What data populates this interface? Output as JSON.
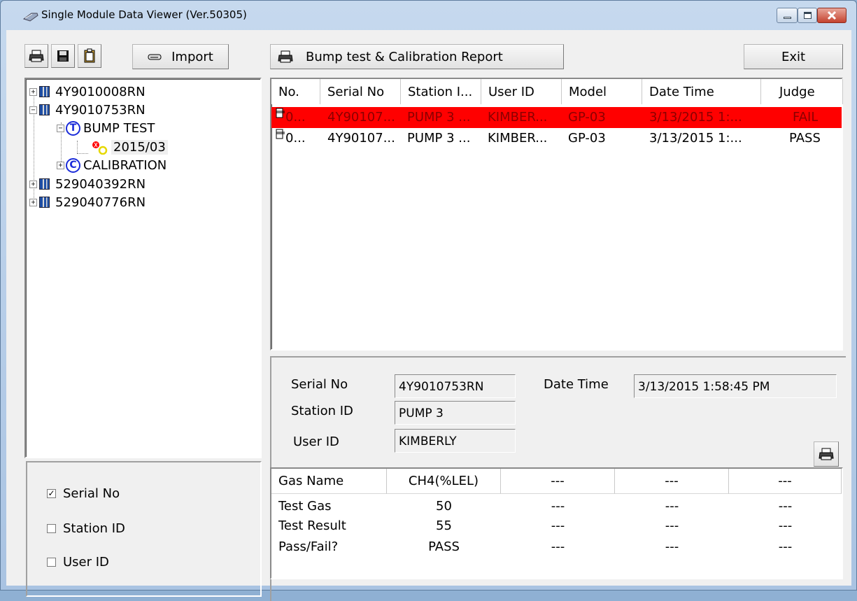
{
  "window": {
    "title": "Single Module Data Viewer (Ver.50305)"
  },
  "toolbar": {
    "import_label": "Import",
    "report_label": "Bump test & Calibration Report",
    "exit_label": "Exit"
  },
  "tree": {
    "n1": "4Y9010008RN",
    "n2": "4Y9010753RN",
    "bump": "BUMP TEST",
    "bump_letter": "T",
    "date": "2015/03",
    "cal": "CALIBRATION",
    "cal_letter": "C",
    "n3": "529040392RN",
    "n4": "529040776RN"
  },
  "filters": {
    "serial": {
      "label": "Serial No",
      "checked": true
    },
    "station": {
      "label": "Station ID",
      "checked": false
    },
    "user": {
      "label": "User ID",
      "checked": false
    }
  },
  "list": {
    "columns": [
      "No.",
      "Serial No",
      "Station I...",
      "User ID",
      "Model",
      "Date Time",
      "Judge"
    ],
    "rows": [
      {
        "no": "0...",
        "serial": "4Y90107...",
        "station": "PUMP 3 ...",
        "user": "KIMBER...",
        "model": "GP-03",
        "datetime": "3/13/2015 1:...",
        "judge": "FAIL"
      },
      {
        "no": "0...",
        "serial": "4Y90107...",
        "station": "PUMP 3 ...",
        "user": "KIMBER...",
        "model": "GP-03",
        "datetime": "3/13/2015 1:...",
        "judge": "PASS"
      }
    ]
  },
  "detail": {
    "serial_label": "Serial No",
    "serial_value": "4Y9010753RN",
    "station_label": "Station ID",
    "station_value": "PUMP 3",
    "user_label": "User ID",
    "user_value": "KIMBERLY",
    "datetime_label": "Date Time",
    "datetime_value": "3/13/2015 1:58:45 PM"
  },
  "gas": {
    "headers": [
      "Gas Name",
      "CH4(%LEL)",
      "---",
      "---",
      "---"
    ],
    "rows": [
      {
        "label": "Test Gas",
        "values": [
          "50",
          "---",
          "---",
          "---"
        ]
      },
      {
        "label": "Test Result",
        "values": [
          "55",
          "---",
          "---",
          "---"
        ]
      },
      {
        "label": "Pass/Fail?",
        "values": [
          "PASS",
          "---",
          "---",
          "---"
        ]
      }
    ]
  },
  "colors": {
    "fail_row_bg": "#ff0000",
    "fail_row_text": "#8b0000"
  }
}
